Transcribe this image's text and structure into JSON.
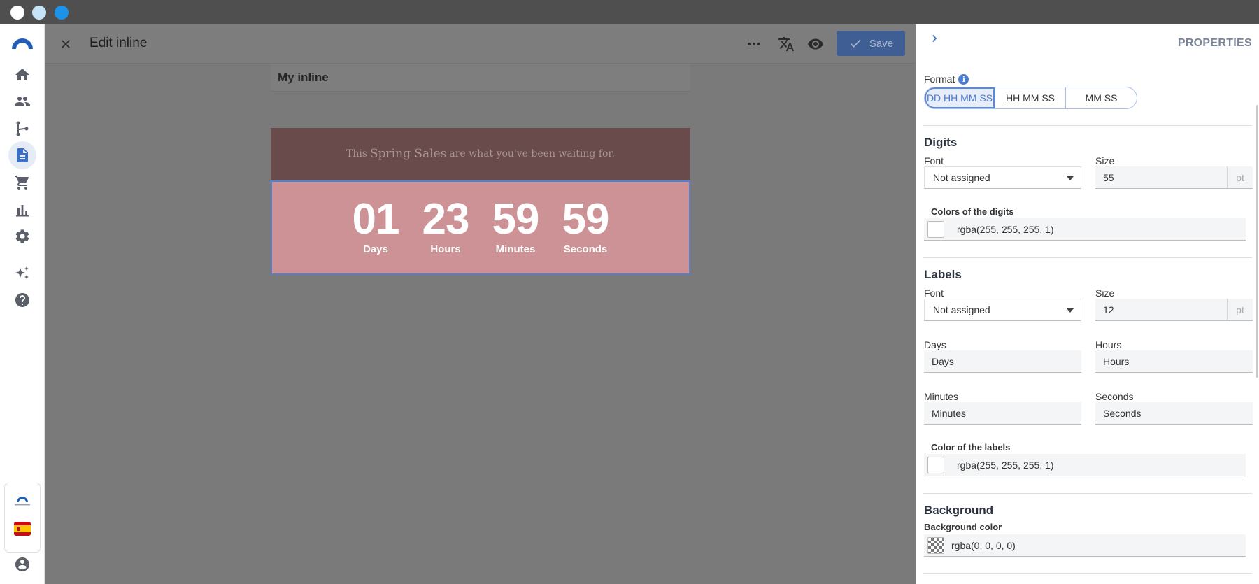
{
  "window": {
    "dot_colors": [
      "#ffffff",
      "#c6e3f7",
      "#1a93e8"
    ]
  },
  "nav": {
    "items": [
      {
        "icon": "home-icon"
      },
      {
        "icon": "people-icon"
      },
      {
        "icon": "flow-icon"
      },
      {
        "icon": "document-icon",
        "active": true
      },
      {
        "icon": "cart-icon"
      },
      {
        "icon": "chart-icon"
      },
      {
        "icon": "gear-icon"
      },
      {
        "icon": "sparkle-icon"
      },
      {
        "icon": "help-icon"
      }
    ],
    "small_logo_text": "CONNECTIF",
    "language_flag": "spain-flag-icon",
    "user_icon": "account-icon"
  },
  "header": {
    "title": "Edit inline",
    "save_label": "Save",
    "icons": [
      "close-icon",
      "more-icon",
      "translate-icon",
      "eye-icon",
      "check-icon"
    ]
  },
  "canvas": {
    "inline_name": "My inline",
    "banner": {
      "pre": "This",
      "highlight": "Spring Sales",
      "post": "are what you've been waiting for."
    },
    "countdown": [
      {
        "value": "01",
        "label": "Days"
      },
      {
        "value": "23",
        "label": "Hours"
      },
      {
        "value": "59",
        "label": "Minutes"
      },
      {
        "value": "59",
        "label": "Seconds"
      }
    ]
  },
  "panel": {
    "title": "PROPERTIES",
    "format": {
      "label": "Format",
      "options": [
        "DD HH MM SS",
        "HH MM SS",
        "MM SS"
      ],
      "selected": "DD HH MM SS"
    },
    "digits": {
      "heading": "Digits",
      "font_label": "Font",
      "font_value": "Not assigned",
      "size_label": "Size",
      "size_value": "55",
      "size_unit": "pt",
      "color_label": "Colors of the digits",
      "color_value": "rgba(255, 255, 255, 1)"
    },
    "labels": {
      "heading": "Labels",
      "font_label": "Font",
      "font_value": "Not assigned",
      "size_label": "Size",
      "size_value": "12",
      "size_unit": "pt",
      "days_label": "Days",
      "days_value": "Days",
      "hours_label": "Hours",
      "hours_value": "Hours",
      "minutes_label": "Minutes",
      "minutes_value": "Minutes",
      "seconds_label": "Seconds",
      "seconds_value": "Seconds",
      "color_label": "Color of the labels",
      "color_value": "rgba(255, 255, 255, 1)"
    },
    "background": {
      "heading": "Background",
      "color_label": "Background color",
      "color_value": "rgba(0, 0, 0, 0)"
    }
  },
  "colors": {
    "accent": "#3c6fc4",
    "save_button": "#3f5e93",
    "banner_bg": "#6a4b4c",
    "countdown_bg": "#cc9295"
  }
}
